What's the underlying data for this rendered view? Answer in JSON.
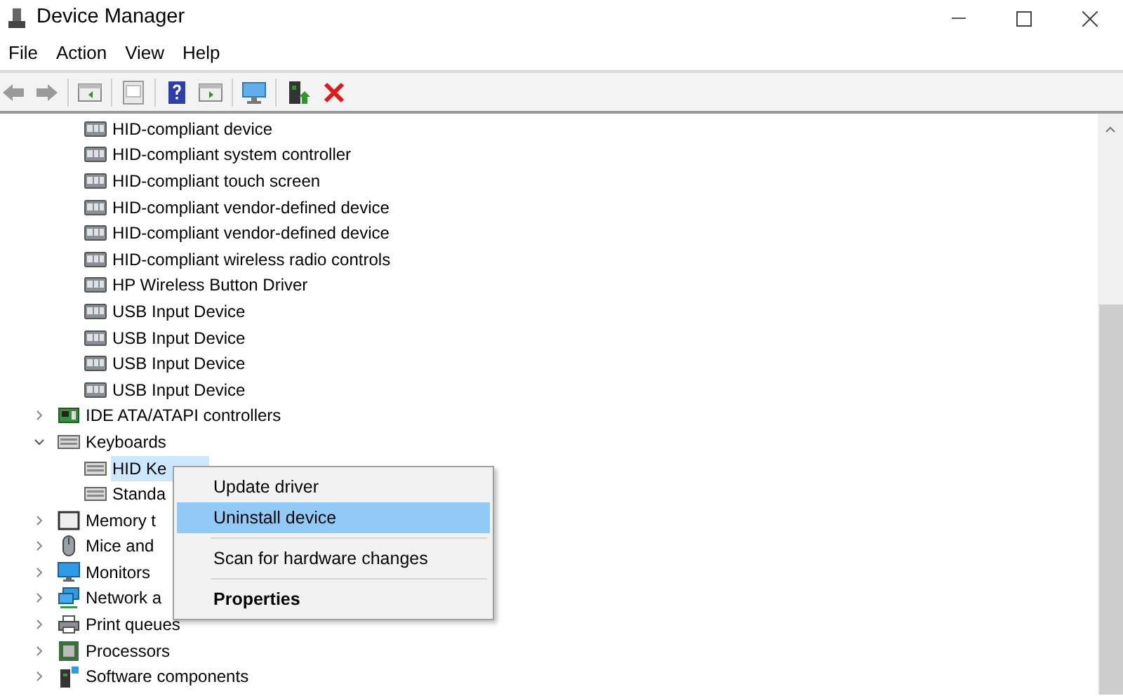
{
  "window": {
    "title": "Device Manager"
  },
  "menu_bar": [
    "File",
    "Action",
    "View",
    "Help"
  ],
  "tree": {
    "continued_children": [
      {
        "label": "HID-compliant device",
        "selected": false
      },
      {
        "label": "HID-compliant system controller",
        "selected": false
      },
      {
        "label": "HID-compliant touch screen",
        "selected": false
      },
      {
        "label": "HID-compliant vendor-defined device",
        "selected": false
      },
      {
        "label": "HID-compliant vendor-defined device",
        "selected": false
      },
      {
        "label": "HID-compliant wireless radio controls",
        "selected": false
      },
      {
        "label": "HP Wireless Button Driver",
        "selected": false
      },
      {
        "label": "USB Input Device",
        "selected": false
      },
      {
        "label": "USB Input Device",
        "selected": false
      },
      {
        "label": "USB Input Device",
        "selected": false
      },
      {
        "label": "USB Input Device",
        "selected": false
      }
    ],
    "categories": [
      {
        "label": "IDE ATA/ATAPI controllers",
        "expanded": false,
        "selected": false
      },
      {
        "label": "Keyboards",
        "expanded": true,
        "selected": false,
        "children": [
          {
            "label": "HID Ke",
            "selected": true
          },
          {
            "label": "Standa",
            "selected": false
          }
        ]
      },
      {
        "label": "Memory t",
        "expanded": false,
        "selected": false
      },
      {
        "label": "Mice and",
        "expanded": false,
        "selected": false
      },
      {
        "label": "Monitors",
        "expanded": false,
        "selected": false
      },
      {
        "label": "Network a",
        "expanded": false,
        "selected": false
      },
      {
        "label": "Print queues",
        "expanded": false,
        "selected": false
      },
      {
        "label": "Processors",
        "expanded": false,
        "selected": false
      },
      {
        "label": "Software components",
        "expanded": false,
        "selected": false
      }
    ]
  },
  "context_menu": [
    {
      "kind": "item",
      "label": "Update driver",
      "selected": false
    },
    {
      "kind": "item",
      "label": "Uninstall device",
      "selected": true
    },
    {
      "kind": "separator"
    },
    {
      "kind": "item",
      "label": "Scan for hardware changes",
      "selected": false
    },
    {
      "kind": "separator"
    },
    {
      "kind": "default",
      "label": "Properties",
      "selected": false
    }
  ]
}
